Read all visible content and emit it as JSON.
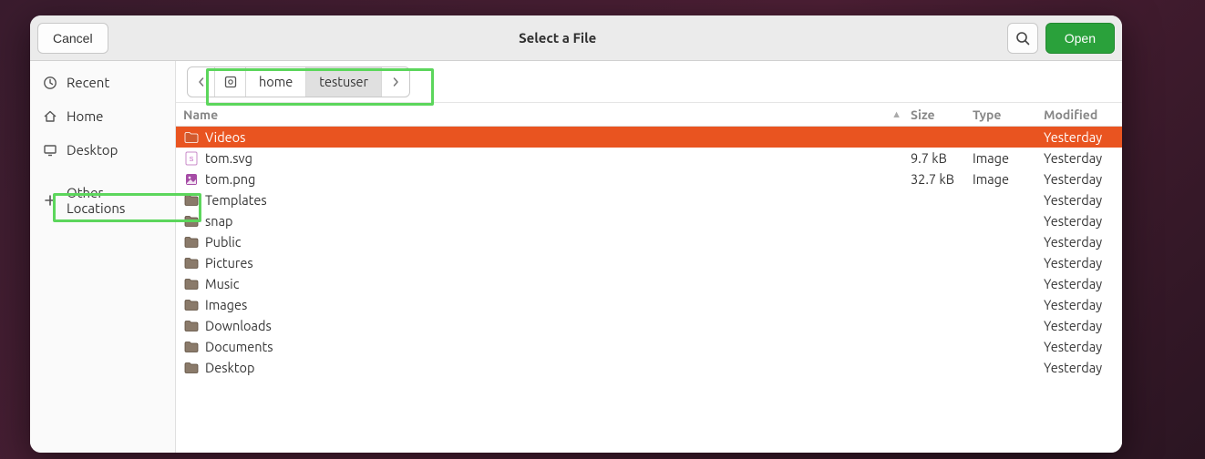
{
  "header": {
    "cancel": "Cancel",
    "title": "Select a File",
    "open": "Open"
  },
  "sidebar": {
    "items": [
      {
        "label": "Recent",
        "icon": "clock-icon"
      },
      {
        "label": "Home",
        "icon": "home-icon"
      },
      {
        "label": "Desktop",
        "icon": "desktop-icon"
      },
      {
        "label": "Other Locations",
        "icon": "plus-icon"
      }
    ]
  },
  "breadcrumb": {
    "segments": [
      {
        "label": "home",
        "active": false
      },
      {
        "label": "testuser",
        "active": true
      }
    ]
  },
  "columns": {
    "name": "Name",
    "size": "Size",
    "type": "Type",
    "modified": "Modified"
  },
  "files": [
    {
      "name": "Videos",
      "size": "",
      "type": "",
      "modified": "Yesterday",
      "icon": "folder",
      "selected": true
    },
    {
      "name": "tom.svg",
      "size": "9.7 kB",
      "type": "Image",
      "modified": "Yesterday",
      "icon": "svg",
      "selected": false
    },
    {
      "name": "tom.png",
      "size": "32.7 kB",
      "type": "Image",
      "modified": "Yesterday",
      "icon": "png",
      "selected": false
    },
    {
      "name": "Templates",
      "size": "",
      "type": "",
      "modified": "Yesterday",
      "icon": "folder",
      "selected": false
    },
    {
      "name": "snap",
      "size": "",
      "type": "",
      "modified": "Yesterday",
      "icon": "folder",
      "selected": false
    },
    {
      "name": "Public",
      "size": "",
      "type": "",
      "modified": "Yesterday",
      "icon": "folder",
      "selected": false
    },
    {
      "name": "Pictures",
      "size": "",
      "type": "",
      "modified": "Yesterday",
      "icon": "folder",
      "selected": false
    },
    {
      "name": "Music",
      "size": "",
      "type": "",
      "modified": "Yesterday",
      "icon": "folder",
      "selected": false
    },
    {
      "name": "Images",
      "size": "",
      "type": "",
      "modified": "Yesterday",
      "icon": "folder",
      "selected": false
    },
    {
      "name": "Downloads",
      "size": "",
      "type": "",
      "modified": "Yesterday",
      "icon": "folder",
      "selected": false
    },
    {
      "name": "Documents",
      "size": "",
      "type": "",
      "modified": "Yesterday",
      "icon": "folder",
      "selected": false
    },
    {
      "name": "Desktop",
      "size": "",
      "type": "",
      "modified": "Yesterday",
      "icon": "folder",
      "selected": false
    }
  ]
}
